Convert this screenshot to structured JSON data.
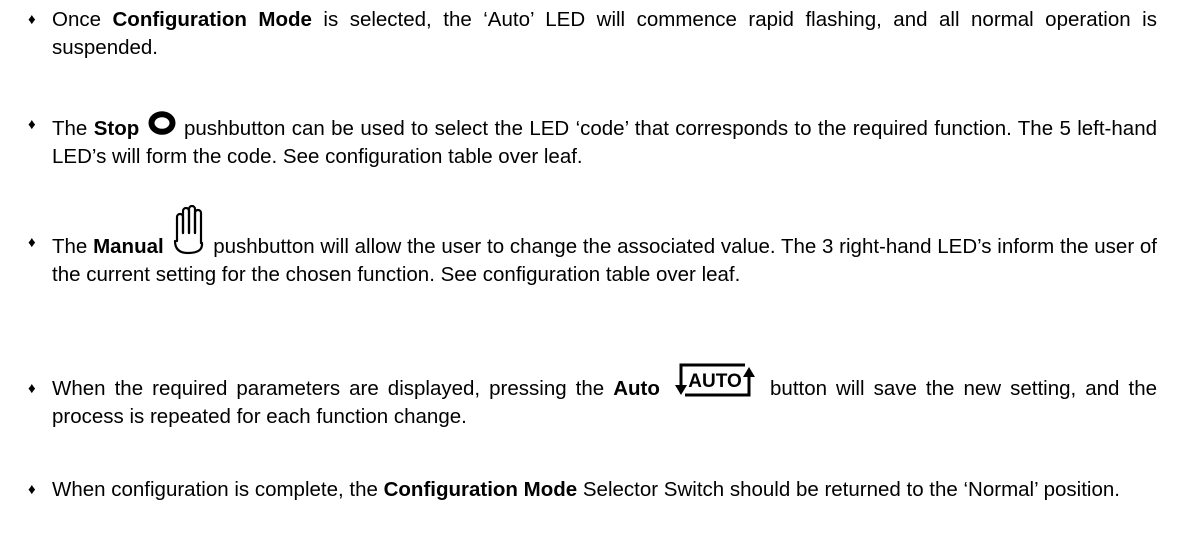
{
  "bullets": [
    {
      "p1": "Once ",
      "b1": "Configuration Mode",
      "p2": " is selected, the ‘Auto’ LED will commence rapid flashing, and all normal operation is suspended."
    },
    {
      "p1": "The ",
      "b1": "Stop",
      "icon": "stop-ring-icon",
      "p2": " pushbutton can be used to select the LED ‘code’ that corresponds to the required function. The 5 left-hand LED’s will form the code. See configuration table over leaf."
    },
    {
      "p1": "The ",
      "b1": "Manual",
      "icon": "hand-icon",
      "p2": " pushbutton will allow the user to change the associated value. The 3 right-hand LED’s inform the user of the current setting for the chosen function. See configuration table over leaf."
    },
    {
      "p1": "When the required parameters are displayed, pressing the ",
      "b1": "Auto",
      "icon": "auto-icon",
      "icon_label": "AUTO",
      "p2": " button will save the new setting, and the process is repeated for each function change."
    },
    {
      "p1": "When configuration is complete, the ",
      "b1": "Configuration Mode",
      "p2": " Selector Switch should be returned to the ‘Normal’ position."
    }
  ],
  "bullet_glyph": "♦",
  "colors": {
    "text": "#000000",
    "background": "#ffffff"
  }
}
